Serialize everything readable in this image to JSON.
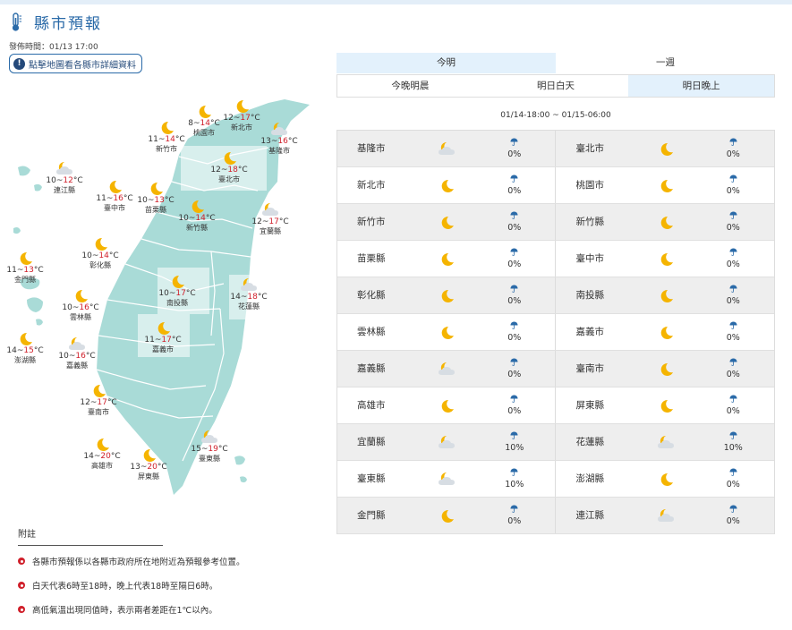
{
  "header": {
    "title": "縣市預報",
    "published": "發佈時間：01/13 17:00",
    "map_button": "點擊地圖看各縣市詳細資料",
    "thermometer_icon": "thermometer-icon"
  },
  "tabs_primary": [
    {
      "label": "今明",
      "active": true
    },
    {
      "label": "一週",
      "active": false
    }
  ],
  "tabs_secondary": [
    {
      "label": "今晚明晨",
      "active": false
    },
    {
      "label": "明日白天",
      "active": false
    },
    {
      "label": "明日晚上",
      "active": true
    }
  ],
  "time_range": "01/14-18:00 ~ 01/15-06:00",
  "colors": {
    "accent": "#2a6aa8",
    "high_temp": "#d0202b",
    "map_land": "#a9dbd7",
    "moon": "#f5b400",
    "umbrella": "#2a6aa8"
  },
  "map_cities": [
    {
      "name": "桃園市",
      "low": "8",
      "high": "14",
      "icon": "moon-icon"
    },
    {
      "name": "新北市",
      "low": "12",
      "high": "17",
      "icon": "moon-icon"
    },
    {
      "name": "新竹市",
      "low": "11",
      "high": "14",
      "icon": "moon-icon"
    },
    {
      "name": "基隆市",
      "low": "13",
      "high": "16",
      "icon": "moon-cloud-icon"
    },
    {
      "name": "臺北市",
      "low": "12",
      "high": "18",
      "icon": "moon-icon"
    },
    {
      "name": "連江縣",
      "low": "10",
      "high": "12",
      "icon": "moon-cloud-icon"
    },
    {
      "name": "臺中市",
      "low": "11",
      "high": "16",
      "icon": "moon-icon"
    },
    {
      "name": "苗栗縣",
      "low": "10",
      "high": "13",
      "icon": "moon-icon"
    },
    {
      "name": "新竹縣",
      "low": "10",
      "high": "14",
      "icon": "moon-icon"
    },
    {
      "name": "宜蘭縣",
      "low": "12",
      "high": "17",
      "icon": "moon-cloud-icon"
    },
    {
      "name": "彰化縣",
      "low": "10",
      "high": "14",
      "icon": "moon-icon"
    },
    {
      "name": "金門縣",
      "low": "11",
      "high": "13",
      "icon": "moon-icon"
    },
    {
      "name": "南投縣",
      "low": "10",
      "high": "17",
      "icon": "moon-icon"
    },
    {
      "name": "花蓮縣",
      "low": "14",
      "high": "18",
      "icon": "moon-cloud-icon"
    },
    {
      "name": "雲林縣",
      "low": "10",
      "high": "16",
      "icon": "moon-icon"
    },
    {
      "name": "嘉義市",
      "low": "11",
      "high": "17",
      "icon": "moon-icon"
    },
    {
      "name": "澎湖縣",
      "low": "14",
      "high": "15",
      "icon": "moon-icon"
    },
    {
      "name": "嘉義縣",
      "low": "10",
      "high": "16",
      "icon": "moon-cloud-icon"
    },
    {
      "name": "臺南市",
      "low": "12",
      "high": "17",
      "icon": "moon-icon"
    },
    {
      "name": "高雄市",
      "low": "14",
      "high": "20",
      "icon": "moon-icon"
    },
    {
      "name": "臺東縣",
      "low": "15",
      "high": "19",
      "icon": "moon-cloud-icon"
    },
    {
      "name": "屏東縣",
      "low": "13",
      "high": "20",
      "icon": "moon-icon"
    }
  ],
  "table_rows": [
    [
      {
        "name": "基隆市",
        "icon": "moon-cloud-icon",
        "rain": "0%"
      },
      {
        "name": "臺北市",
        "icon": "moon-icon",
        "rain": "0%"
      }
    ],
    [
      {
        "name": "新北市",
        "icon": "moon-icon",
        "rain": "0%"
      },
      {
        "name": "桃園市",
        "icon": "moon-icon",
        "rain": "0%"
      }
    ],
    [
      {
        "name": "新竹市",
        "icon": "moon-icon",
        "rain": "0%"
      },
      {
        "name": "新竹縣",
        "icon": "moon-icon",
        "rain": "0%"
      }
    ],
    [
      {
        "name": "苗栗縣",
        "icon": "moon-icon",
        "rain": "0%"
      },
      {
        "name": "臺中市",
        "icon": "moon-icon",
        "rain": "0%"
      }
    ],
    [
      {
        "name": "彰化縣",
        "icon": "moon-icon",
        "rain": "0%"
      },
      {
        "name": "南投縣",
        "icon": "moon-icon",
        "rain": "0%"
      }
    ],
    [
      {
        "name": "雲林縣",
        "icon": "moon-icon",
        "rain": "0%"
      },
      {
        "name": "嘉義市",
        "icon": "moon-icon",
        "rain": "0%"
      }
    ],
    [
      {
        "name": "嘉義縣",
        "icon": "moon-cloud-icon",
        "rain": "0%"
      },
      {
        "name": "臺南市",
        "icon": "moon-icon",
        "rain": "0%"
      }
    ],
    [
      {
        "name": "高雄市",
        "icon": "moon-icon",
        "rain": "0%"
      },
      {
        "name": "屏東縣",
        "icon": "moon-icon",
        "rain": "0%"
      }
    ],
    [
      {
        "name": "宜蘭縣",
        "icon": "moon-cloud-icon",
        "rain": "10%"
      },
      {
        "name": "花蓮縣",
        "icon": "moon-cloud-icon",
        "rain": "10%"
      }
    ],
    [
      {
        "name": "臺東縣",
        "icon": "moon-cloud-icon",
        "rain": "10%"
      },
      {
        "name": "澎湖縣",
        "icon": "moon-icon",
        "rain": "0%"
      }
    ],
    [
      {
        "name": "金門縣",
        "icon": "moon-icon",
        "rain": "0%"
      },
      {
        "name": "連江縣",
        "icon": "moon-cloud-icon",
        "rain": "0%"
      }
    ]
  ],
  "notes": {
    "title": "附註",
    "items": [
      "各縣市預報係以各縣市政府所在地附近為預報參考位置。",
      "白天代表6時至18時，晚上代表18時至隔日6時。",
      "高低氣溫出現同值時，表示兩者差距在1℃以內。"
    ]
  }
}
